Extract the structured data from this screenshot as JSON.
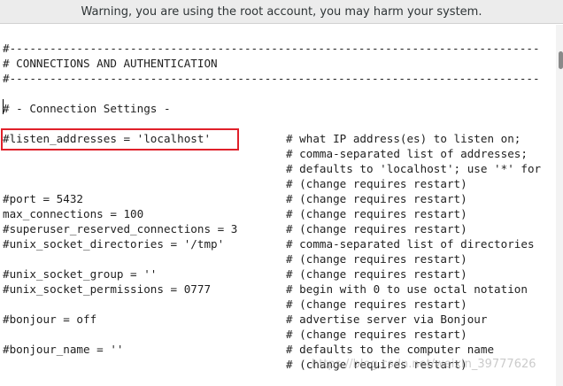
{
  "warning": {
    "text": "Warning, you are using the root account, you may harm your system."
  },
  "editor": {
    "lines": [
      "#-------------------------------------------------------------------------------",
      "# CONNECTIONS AND AUTHENTICATION",
      "#-------------------------------------------------------------------------------",
      "",
      "# - Connection Settings -",
      "",
      "#listen_addresses = 'localhost'",
      "",
      "",
      "",
      "#port = 5432",
      "max_connections = 100",
      "#superuser_reserved_connections = 3",
      "#unix_socket_directories = '/tmp'",
      "",
      "#unix_socket_group = ''",
      "#unix_socket_permissions = 0777",
      "",
      "#bonjour = off",
      "",
      "#bonjour_name = ''",
      ""
    ],
    "comments": [
      "",
      "",
      "",
      "",
      "",
      "",
      "# what IP address(es) to listen on;",
      "# comma-separated list of addresses;",
      "# defaults to 'localhost'; use '*' for",
      "# (change requires restart)",
      "# (change requires restart)",
      "# (change requires restart)",
      "# (change requires restart)",
      "# comma-separated list of directories",
      "# (change requires restart)",
      "# (change requires restart)",
      "# begin with 0 to use octal notation",
      "# (change requires restart)",
      "# advertise server via Bonjour",
      "# (change requires restart)",
      "# defaults to the computer name",
      "# (change requires restart)"
    ],
    "highlight_color": "#e0202a"
  },
  "watermark": {
    "text": "https://blog.csdn.net/weixin_39777626"
  }
}
